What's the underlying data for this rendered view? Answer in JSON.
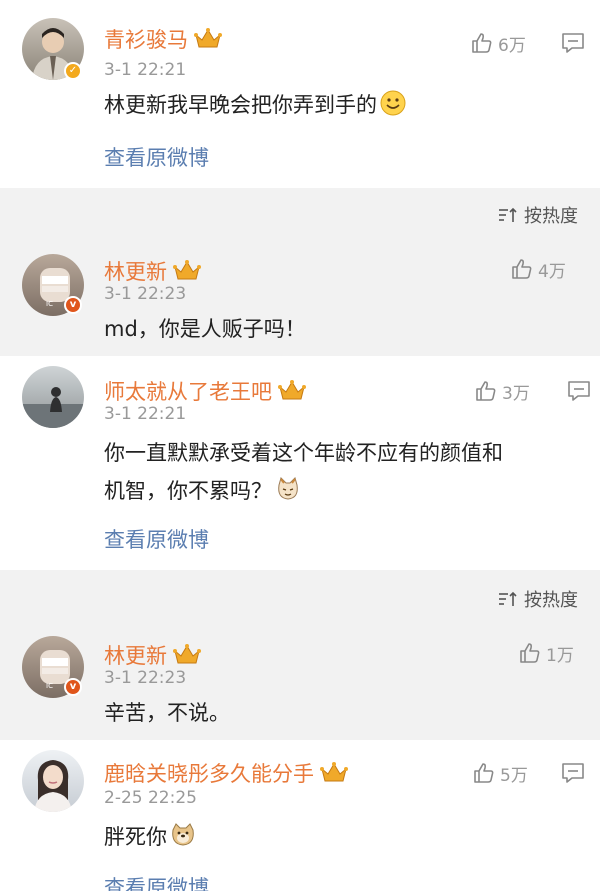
{
  "comments": [
    {
      "name": "青衫骏马",
      "time": "3-1 22:21",
      "text": "林更新我早晚会把你弄到手的",
      "likes": "6万",
      "view_link": "查看原微博",
      "avatar_icon": "man-portrait-avatar",
      "badge": "verified-yellow"
    },
    {
      "name": "林更新",
      "time": "3-1 22:23",
      "text": "md，你是人贩子吗！",
      "likes": "4万",
      "avatar_icon": "bandaged-hand-avatar",
      "badge": "verified-orange"
    },
    {
      "name": "师太就从了老王吧",
      "time": "3-1 22:21",
      "text_line1": "你一直默默承受着这个年龄不应有的颜值和",
      "text_line2": "机智，你不累吗？",
      "likes": "3万",
      "view_link": "查看原微博",
      "avatar_icon": "silhouette-landscape-avatar"
    },
    {
      "name": "林更新",
      "time": "3-1 22:23",
      "text": "辛苦，不说。",
      "likes": "1万",
      "avatar_icon": "bandaged-hand-avatar",
      "badge": "verified-orange"
    },
    {
      "name": "鹿晗关晓彤多久能分手",
      "time": "2-25 22:25",
      "text": "胖死你",
      "likes": "5万",
      "view_link": "查看原微博",
      "avatar_icon": "girl-portrait-avatar"
    }
  ],
  "sort_label": "按热度",
  "colors": {
    "name": "#e8793a",
    "link": "#5b7eb0",
    "meta": "#999999",
    "separator": "#f2f2f2"
  }
}
